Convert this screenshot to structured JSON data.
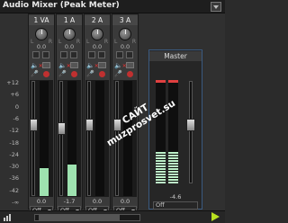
{
  "window": {
    "title": "Audio Mixer (Peak Meter)"
  },
  "channels": [
    {
      "name": "1 VA",
      "pan": "0.0",
      "db": "0.0",
      "select": "Off",
      "level_fraction": 0.24
    },
    {
      "name": "1 A",
      "pan": "0.0",
      "db": "-1.7",
      "select": "Off",
      "level_fraction": 0.27
    },
    {
      "name": "2 A",
      "pan": "0.0",
      "db": "0.0",
      "select": "Off",
      "level_fraction": 0.0
    },
    {
      "name": "3 A",
      "pan": "0.0",
      "db": "0.0",
      "select": "Off",
      "level_fraction": 0.0
    }
  ],
  "pan_labels": {
    "left": "L",
    "right": "R"
  },
  "scale": [
    "+12",
    "+6",
    "0",
    "-6",
    "-12",
    "-18",
    "-24",
    "-30",
    "-36",
    "-42",
    "-∞"
  ],
  "master": {
    "name": "Master",
    "db": "-4.6",
    "select": "Off",
    "level_fraction": 0.3
  },
  "watermark": {
    "line1": "САЙТ",
    "line2": "muzprosvet.su"
  },
  "colors": {
    "meter": "#9ee2b0",
    "peak": "#e04040",
    "accent": "#b8e020",
    "master_border": "#3a5a80"
  },
  "icons": {
    "mute": "speaker-mute-icon",
    "record": "record-icon",
    "play": "play-icon",
    "meter_options": "bars-icon"
  }
}
